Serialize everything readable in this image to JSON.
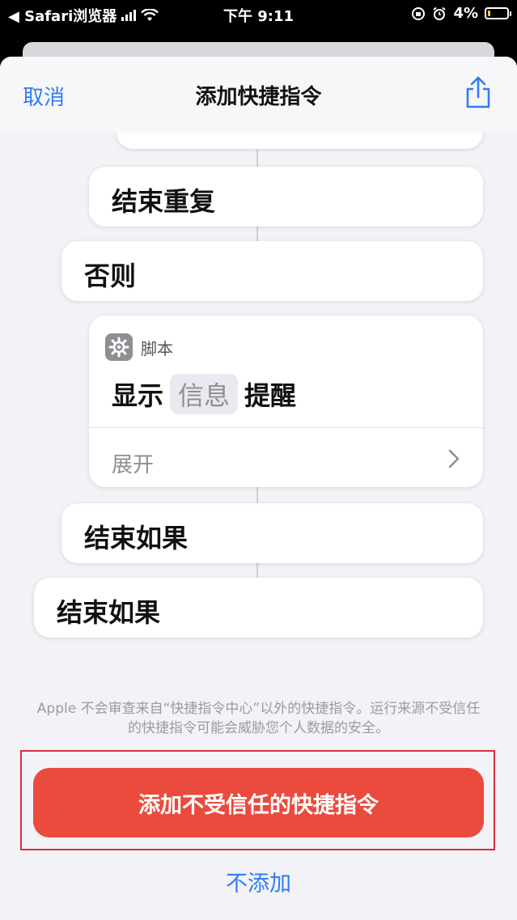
{
  "status_bar": {
    "back_app": "◀ Safari浏览器",
    "time": "下午 9:11",
    "battery": "4%"
  },
  "nav": {
    "cancel": "取消",
    "title": "添加快捷指令",
    "share_icon": "share-icon"
  },
  "blocks": {
    "partial_top": "",
    "end_repeat": "结束重复",
    "otherwise": "否则",
    "script": {
      "app": "脚本",
      "verb": "显示",
      "token": "信息",
      "noun": "提醒",
      "expand": "展开"
    },
    "end_if_1": "结束如果",
    "end_if_2": "结束如果"
  },
  "warning": "Apple 不会审查来自“快捷指令中心”以外的快捷指令。运行来源不受信任的快捷指令可能会威胁您个人数据的安全。",
  "actions": {
    "add_untrusted": "添加不受信任的快捷指令",
    "dont_add": "不添加"
  },
  "colors": {
    "accent": "#2f7cf6",
    "danger": "#ea4b3c",
    "highlight_border": "#d32f3c"
  }
}
